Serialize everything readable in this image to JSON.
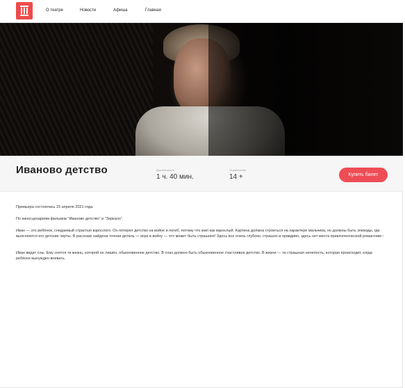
{
  "header": {
    "nav": [
      {
        "label": "О театре"
      },
      {
        "label": "Новости"
      },
      {
        "label": "Афиша"
      },
      {
        "label": "Главная"
      }
    ]
  },
  "performance": {
    "title": "Иваново детство",
    "duration_label": "Длительность",
    "duration_value": "1 ч. 40 мин.",
    "age_label": "Ограничение",
    "age_value": "14 +",
    "buy_label": "Купить билет"
  },
  "content": {
    "premiere": "Премьера состоялась 15 апреля 2021 года.",
    "basis": "По киносценариям фильмов \"Иваново детство\" и \"Зеркало\".",
    "quote1": "Иван — это ребёнок, снедаемый страстью взрослого. Он потерял детство на войне и погиб, потому что жил как взрослый. Картина должна строиться на характере мальчика, но должны быть эпизоды, где выясняются его детские черты. В рассказе найдена точная деталь — игра в войну — что может быть страшнее! Здесь все очень глубоко, страшно и правдиво, здесь нет места приключенческой романтике~",
    "quote2": "Иван видит сны. Ему снятся та жизнь, которой он лишён, обыкновенное детство. В снах должно быть обыкновенное счастливое детство. В жизни — та страшная нелепость, которая происходит, когда ребёнок вынужден воевать."
  }
}
